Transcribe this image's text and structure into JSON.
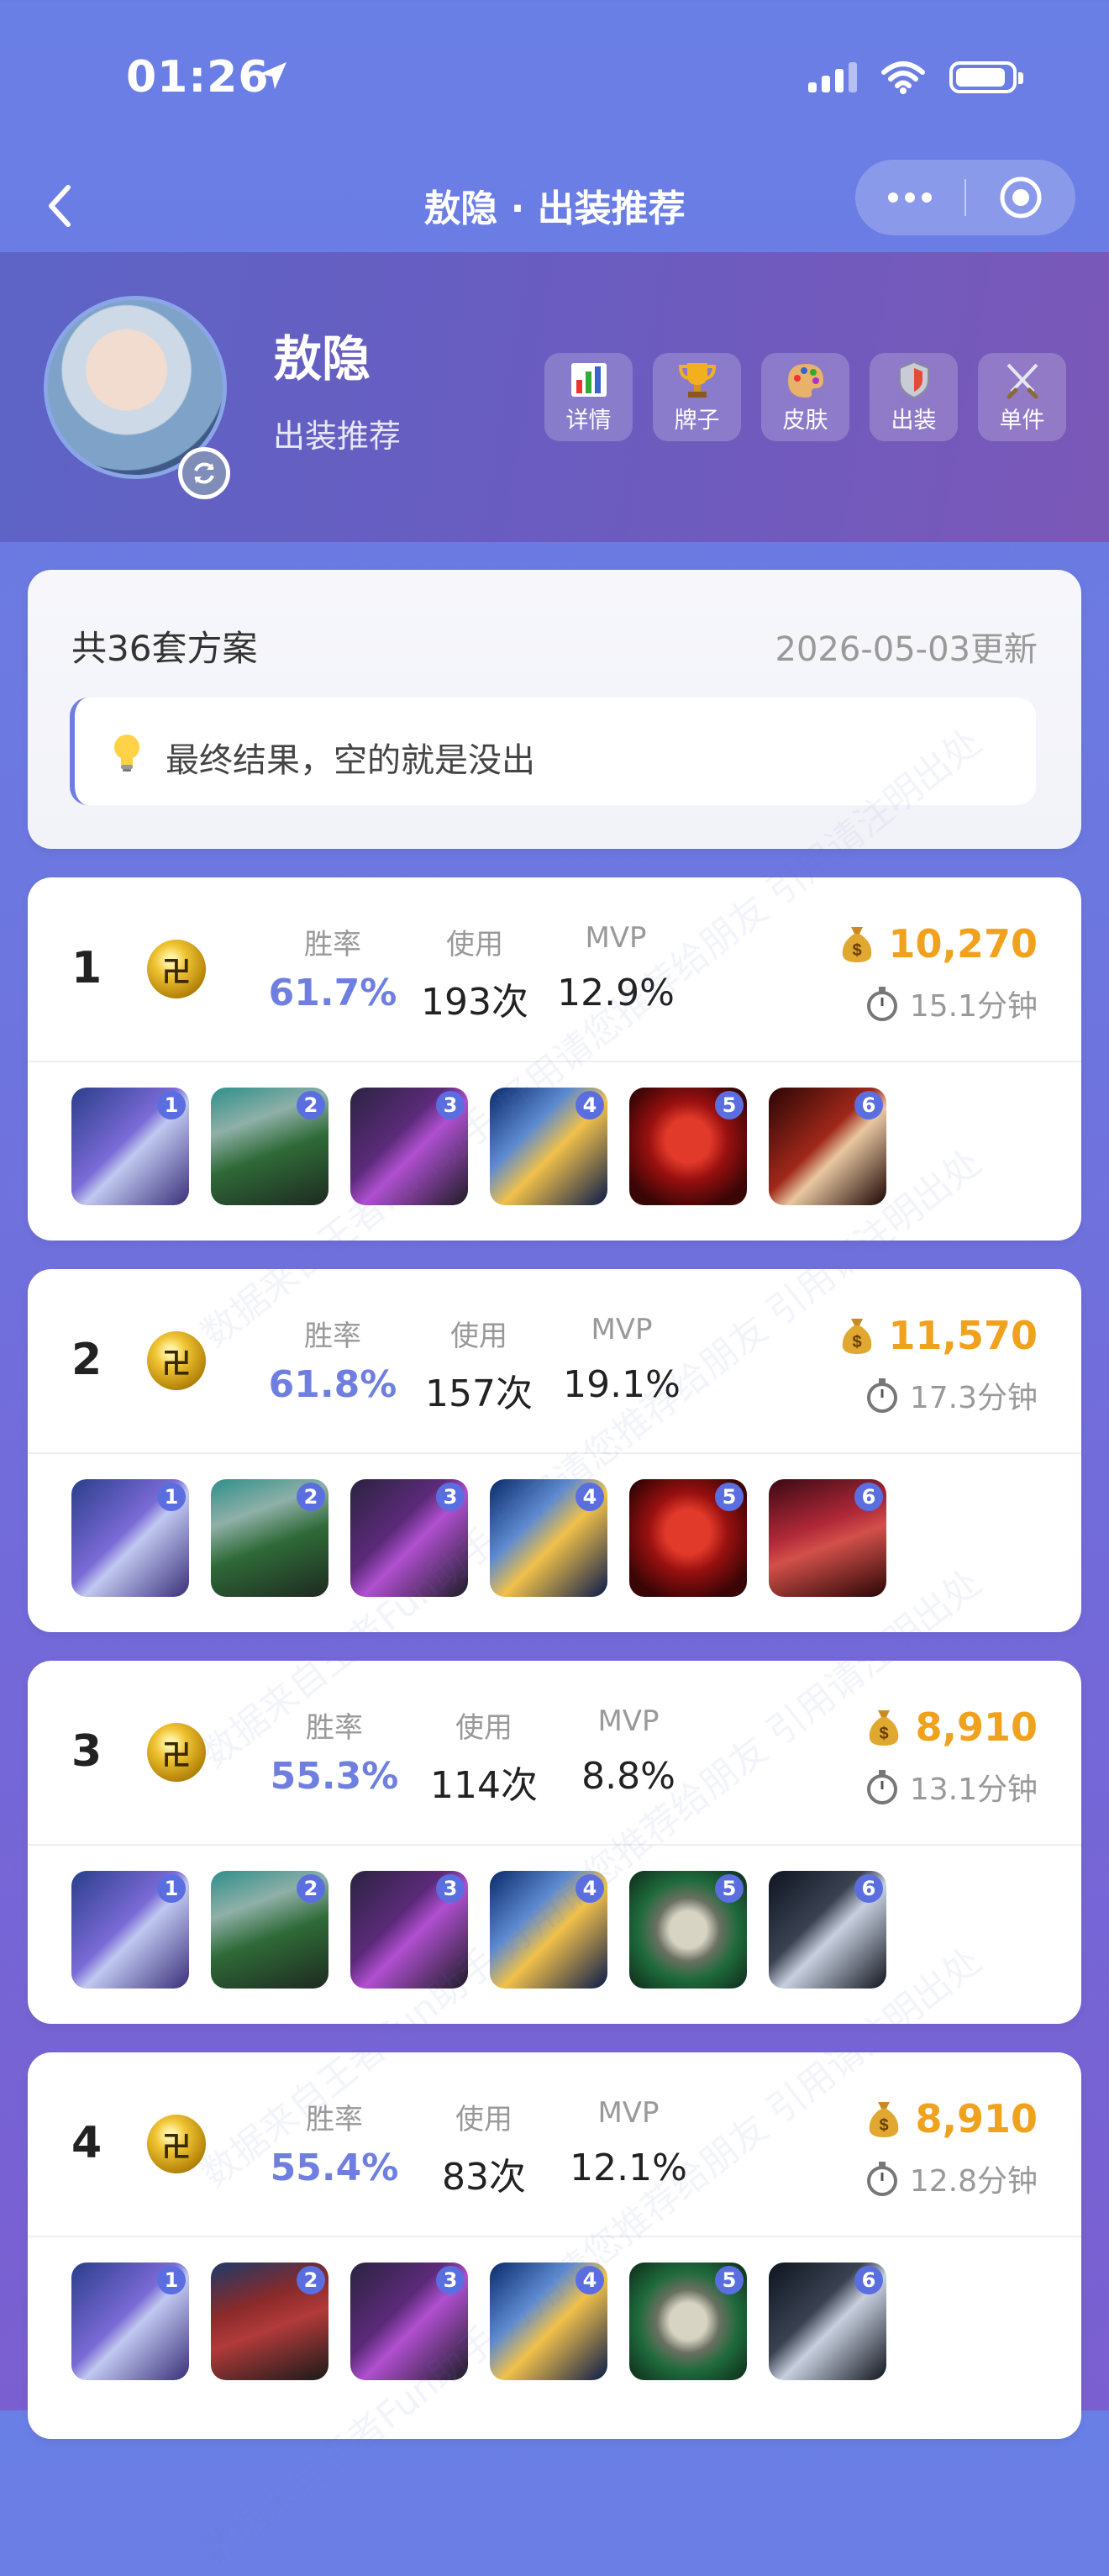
{
  "status_bar": {
    "time": "01:26"
  },
  "nav": {
    "title": "敖隐 · 出装推荐"
  },
  "hero": {
    "name": "敖隐",
    "subtitle": "出装推荐",
    "actions": [
      {
        "label": "详情",
        "icon": "bar-chart-icon"
      },
      {
        "label": "牌子",
        "icon": "trophy-icon"
      },
      {
        "label": "皮肤",
        "icon": "palette-icon"
      },
      {
        "label": "出装",
        "icon": "shield-icon"
      },
      {
        "label": "单件",
        "icon": "crossed-swords-icon"
      }
    ]
  },
  "summary": {
    "count_text": "共36套方案",
    "updated_text": "2026-05-03更新",
    "tip": "最终结果，空的就是没出"
  },
  "labels": {
    "win_rate": "胜率",
    "usage": "使用",
    "mvp": "MVP"
  },
  "builds": [
    {
      "rank": "1",
      "win_rate": "61.7%",
      "usage": "193次",
      "mvp": "12.9%",
      "gold": "10,270",
      "duration": "15.1分钟",
      "items": [
        {
          "num": "1",
          "icon": "purple-armor-item"
        },
        {
          "num": "2",
          "icon": "green-boots-item"
        },
        {
          "num": "3",
          "icon": "purple-claw-item"
        },
        {
          "num": "4",
          "icon": "gold-trident-item"
        },
        {
          "num": "5",
          "icon": "red-helm-item"
        },
        {
          "num": "6",
          "icon": "red-blade-item"
        }
      ]
    },
    {
      "rank": "2",
      "win_rate": "61.8%",
      "usage": "157次",
      "mvp": "19.1%",
      "gold": "11,570",
      "duration": "17.3分钟",
      "items": [
        {
          "num": "1",
          "icon": "purple-armor-item"
        },
        {
          "num": "2",
          "icon": "green-boots-item"
        },
        {
          "num": "3",
          "icon": "purple-claw-item"
        },
        {
          "num": "4",
          "icon": "gold-trident-item"
        },
        {
          "num": "5",
          "icon": "red-helm-item"
        },
        {
          "num": "6",
          "icon": "red-wing-item"
        }
      ]
    },
    {
      "rank": "3",
      "win_rate": "55.3%",
      "usage": "114次",
      "mvp": "8.8%",
      "gold": "8,910",
      "duration": "13.1分钟",
      "items": [
        {
          "num": "1",
          "icon": "purple-armor-item"
        },
        {
          "num": "2",
          "icon": "green-boots-item"
        },
        {
          "num": "3",
          "icon": "purple-claw-item"
        },
        {
          "num": "4",
          "icon": "gold-trident-item"
        },
        {
          "num": "5",
          "icon": "green-shield-item"
        },
        {
          "num": "6",
          "icon": "silver-spear-item"
        }
      ]
    },
    {
      "rank": "4",
      "win_rate": "55.4%",
      "usage": "83次",
      "mvp": "12.1%",
      "gold": "8,910",
      "duration": "12.8分钟",
      "items": [
        {
          "num": "1",
          "icon": "purple-armor-item"
        },
        {
          "num": "2",
          "icon": "red-boots-item"
        },
        {
          "num": "3",
          "icon": "purple-claw-item"
        },
        {
          "num": "4",
          "icon": "gold-trident-item"
        },
        {
          "num": "5",
          "icon": "green-shield-item"
        },
        {
          "num": "6",
          "icon": "silver-spear-item"
        }
      ]
    }
  ],
  "watermark": "数据来自王者Fun助手 好用请您推荐给朋友 引用请注明出处",
  "colors": {
    "accent": "#6e7fe0",
    "gold": "#f0a21e",
    "badge": "#5b6ee0"
  }
}
